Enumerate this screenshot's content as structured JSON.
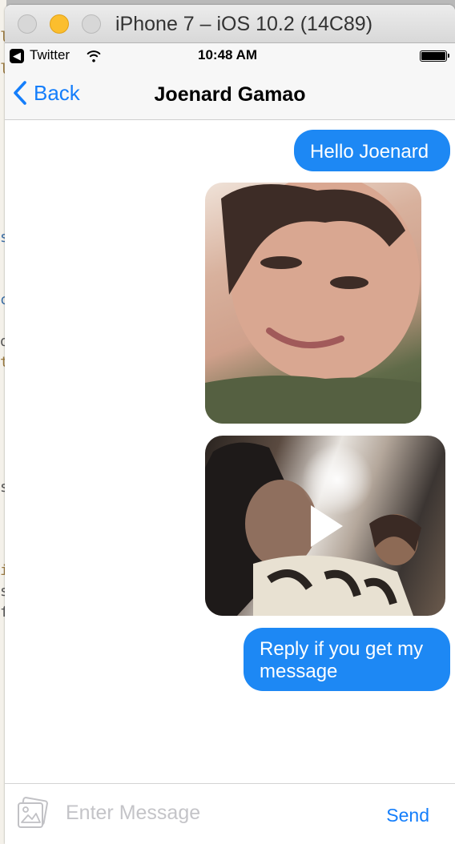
{
  "window": {
    "title": "iPhone 7 – iOS 10.2 (14C89)"
  },
  "status_bar": {
    "app_name": "Twitter",
    "time": "10:48 AM"
  },
  "nav": {
    "back_label": "Back",
    "title": "Joenard Gamao"
  },
  "messages": [
    {
      "type": "text",
      "text": "Hello Joenard",
      "sender": "outgoing"
    },
    {
      "type": "photo",
      "sender": "outgoing"
    },
    {
      "type": "video",
      "sender": "outgoing"
    },
    {
      "type": "text",
      "text": "Reply if you get my message",
      "sender": "outgoing"
    }
  ],
  "input": {
    "placeholder": "Enter Message",
    "value": "",
    "send_label": "Send"
  },
  "colors": {
    "accent": "#147efb",
    "bubble": "#1d88f4",
    "traffic_minimize": "#fbbe2e"
  },
  "icons": {
    "back": "chevron-left-icon",
    "wifi": "wifi-icon",
    "battery": "battery-icon",
    "attach": "photo-icon",
    "play": "play-icon"
  }
}
